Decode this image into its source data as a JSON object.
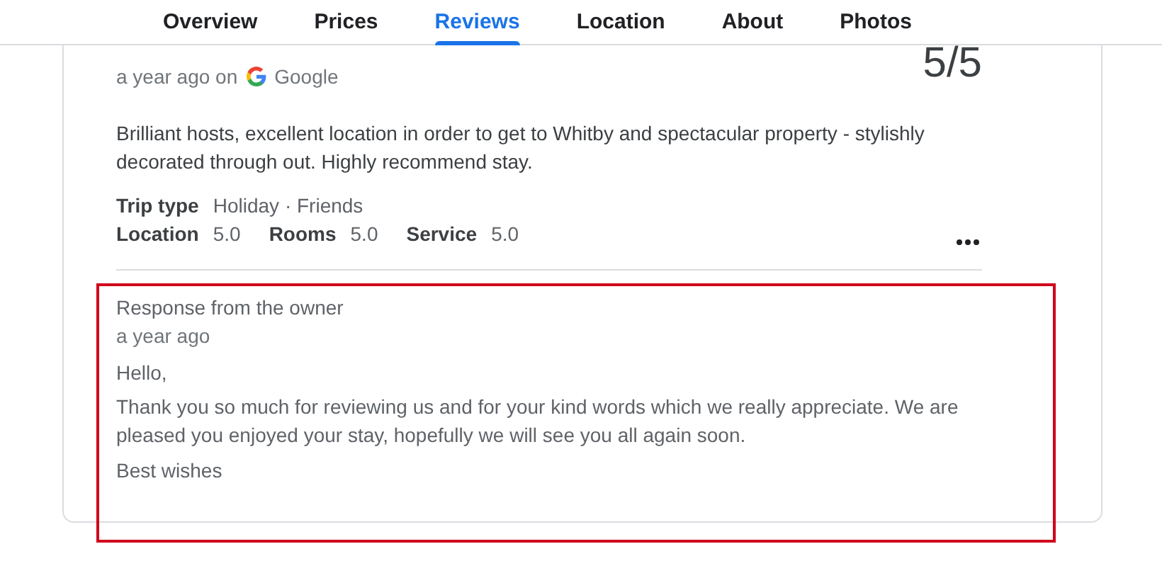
{
  "tabs": [
    {
      "label": "Overview",
      "selected": false
    },
    {
      "label": "Prices",
      "selected": false
    },
    {
      "label": "Reviews",
      "selected": true
    },
    {
      "label": "Location",
      "selected": false
    },
    {
      "label": "About",
      "selected": false
    },
    {
      "label": "Photos",
      "selected": false
    }
  ],
  "review": {
    "time": "a year ago on",
    "source": "Google",
    "rating": "5/5",
    "text": "Brilliant hosts, excellent location in order to get to Whitby and spectacular property - stylishly decorated through out. Highly recommend stay.",
    "trip_type_label": "Trip type",
    "trip_type": "Holiday · Friends",
    "scores": [
      {
        "label": "Location",
        "value": "5.0"
      },
      {
        "label": "Rooms",
        "value": "5.0"
      },
      {
        "label": "Service",
        "value": "5.0"
      }
    ]
  },
  "owner_response": {
    "title": "Response from the owner",
    "time": "a year ago",
    "highlighted": true,
    "paragraphs": [
      "Hello,",
      "Thank you so much for reviewing us and for your kind words which we really appreciate. We are pleased you enjoyed your stay, hopefully we will see you all again soon.",
      "Best wishes"
    ]
  }
}
